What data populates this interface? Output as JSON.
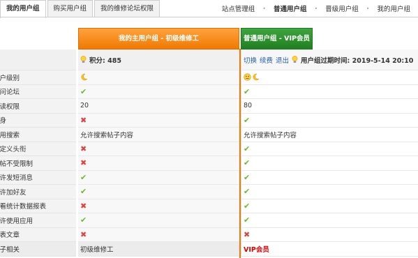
{
  "tabs": [
    {
      "label": "我的用户组",
      "active": true
    },
    {
      "label": "购买用户组",
      "active": false
    },
    {
      "label": "我的维修论坛权限",
      "active": false
    }
  ],
  "topnav": [
    {
      "label": "站点管理组",
      "current": false
    },
    {
      "label": "普通用户组",
      "current": true
    },
    {
      "label": "晋级用户组",
      "current": false
    },
    {
      "label": "我的用户组",
      "current": false
    }
  ],
  "columns": {
    "mine": "我的主用户组 - 初级维修工",
    "normal": "普通用户组 - VIP会员"
  },
  "score_row": {
    "points_label": "积分: 485",
    "switch_link": "切换",
    "renew_link": "续费",
    "exit_link": "退出",
    "expiry": "用户组过期时间: 2019-5-14 20:10"
  },
  "rows": [
    {
      "label": "用户级别",
      "mine": "moon",
      "normal": "face+moon"
    },
    {
      "label": "访问论坛",
      "mine": "ok",
      "normal": "ok"
    },
    {
      "label": "阅读权限",
      "mine": "20",
      "normal": "80"
    },
    {
      "label": "隐身",
      "mine": "no",
      "normal": "ok"
    },
    {
      "label": "使用搜索",
      "mine": "允许搜索帖子内容",
      "normal": "允许搜索帖子内容"
    },
    {
      "label": "自定义头衔",
      "mine": "no",
      "normal": "ok"
    },
    {
      "label": "发帖不受限制",
      "mine": "no",
      "normal": "ok"
    },
    {
      "label": "允许发短消息",
      "mine": "ok",
      "normal": "ok"
    },
    {
      "label": "允许加好友",
      "mine": "ok",
      "normal": "ok"
    },
    {
      "label": "查看统计数据报表",
      "mine": "no",
      "normal": "ok"
    },
    {
      "label": "允许使用应用",
      "mine": "ok",
      "normal": "ok"
    },
    {
      "label": "发表文章",
      "mine": "no",
      "normal": "no"
    },
    {
      "label": "帖子相关",
      "mine": "初级维修工",
      "normal": "VIP会员"
    }
  ],
  "symbols": {
    "ok": "✔",
    "no": "✖"
  },
  "colors": {
    "orange": "#f07a00",
    "green": "#207f20",
    "ok": "#6ab82e",
    "no": "#e04040",
    "vip": "#e00000"
  }
}
